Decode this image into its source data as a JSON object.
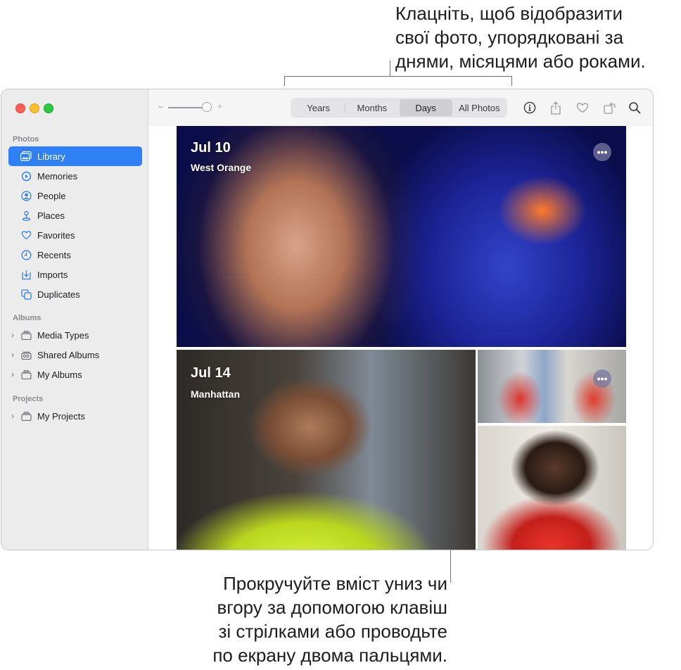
{
  "callouts": {
    "top": [
      "Клацніть, щоб відобразити",
      "свої фото, упорядковані за",
      "днями, місяцями або роками."
    ],
    "bottom": [
      "Прокручуйте вміст униз чи",
      "вгору за допомогою клавіш",
      "зі стрілками або проводьте",
      "по екрану двома пальцями."
    ]
  },
  "sidebar": {
    "sections": {
      "photos": "Photos",
      "albums": "Albums",
      "projects": "Projects"
    },
    "photos_items": [
      {
        "label": "Library",
        "icon": "library-icon",
        "selected": true
      },
      {
        "label": "Memories",
        "icon": "memories-icon"
      },
      {
        "label": "People",
        "icon": "people-icon"
      },
      {
        "label": "Places",
        "icon": "places-icon"
      },
      {
        "label": "Favorites",
        "icon": "heart-icon"
      },
      {
        "label": "Recents",
        "icon": "clock-icon"
      },
      {
        "label": "Imports",
        "icon": "import-icon"
      },
      {
        "label": "Duplicates",
        "icon": "duplicates-icon"
      }
    ],
    "albums_items": [
      {
        "label": "Media Types",
        "icon": "folder-stack-icon"
      },
      {
        "label": "Shared Albums",
        "icon": "shared-album-icon"
      },
      {
        "label": "My Albums",
        "icon": "folder-stack-icon"
      }
    ],
    "projects_items": [
      {
        "label": "My Projects",
        "icon": "folder-stack-icon"
      }
    ]
  },
  "toolbar": {
    "zoom_minus": "–",
    "zoom_plus": "+",
    "zoom_level": 0.8,
    "segments": [
      {
        "label": "Years"
      },
      {
        "label": "Months"
      },
      {
        "label": "Days",
        "active": true
      },
      {
        "label": "All Photos"
      }
    ],
    "icons": [
      "info-icon",
      "share-icon",
      "heart-icon",
      "rotate-icon",
      "search-icon"
    ]
  },
  "content": {
    "days": [
      {
        "date": "Jul 10",
        "place": "West Orange",
        "more": "•••"
      },
      {
        "date": "Jul 14",
        "place": "Manhattan",
        "more": "•••"
      }
    ]
  },
  "colors": {
    "accent": "#2f7ff5",
    "sidebar_bg": "#ececec",
    "toolbar_bg": "#f5f5f5"
  }
}
